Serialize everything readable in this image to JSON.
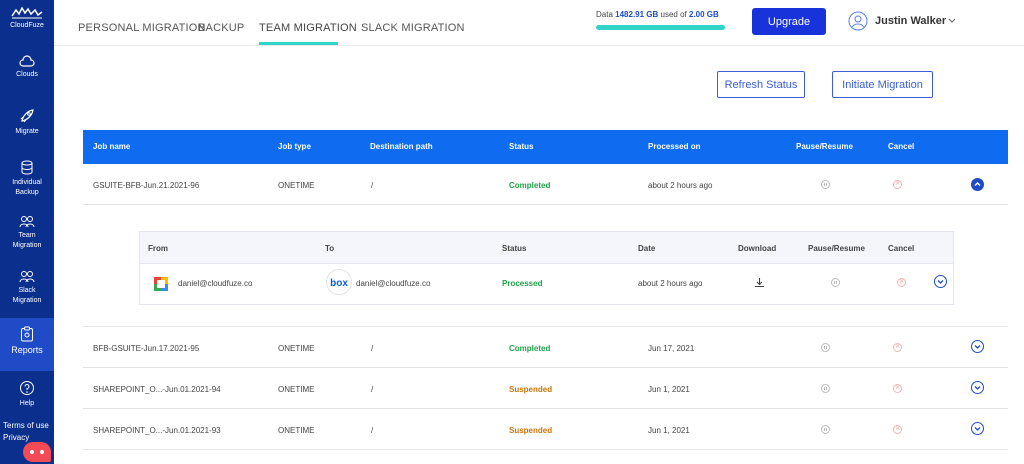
{
  "sidebar": {
    "logo_text": "CloudFuze",
    "items": [
      {
        "label": "Clouds",
        "icon": "cloud-icon"
      },
      {
        "label": "Migrate",
        "icon": "rocket-icon"
      },
      {
        "label": "Individual Backup",
        "icon": "database-icon"
      },
      {
        "label": "Team Migration",
        "icon": "users-icon"
      },
      {
        "label": "Slack Migration",
        "icon": "users-icon"
      },
      {
        "label": "Reports",
        "icon": "clipboard-icon"
      },
      {
        "label": "Help",
        "icon": "help-icon"
      }
    ],
    "footer_line1": "Terms of use",
    "footer_line2": "Privacy"
  },
  "tabs": [
    {
      "label": "PERSONAL MIGRATION"
    },
    {
      "label": "BACKUP"
    },
    {
      "label": "TEAM MIGRATION",
      "active": true
    },
    {
      "label": "SLACK MIGRATION"
    }
  ],
  "storage": {
    "prefix": "Data",
    "used": "1482.91 GB",
    "middle": "used of",
    "total": "2.00 GB"
  },
  "upgrade_label": "Upgrade",
  "user": {
    "name": "Justin Walker"
  },
  "actions": {
    "refresh": "Refresh Status",
    "initiate": "Initiate Migration"
  },
  "table": {
    "headers": [
      "Job name",
      "Job type",
      "Destination path",
      "Status",
      "Processed on",
      "Pause/Resume",
      "Cancel"
    ],
    "rows": [
      {
        "name": "GSUITE-BFB-Jun.21.2021-96",
        "type": "ONETIME",
        "path": "/",
        "status": "Completed",
        "processed": "about 2 hours ago",
        "expanded": true
      },
      {
        "name": "BFB-GSUITE-Jun.17.2021-95",
        "type": "ONETIME",
        "path": "/",
        "status": "Completed",
        "processed": "Jun 17, 2021"
      },
      {
        "name": "SHAREPOINT_O...-Jun.01.2021-94",
        "type": "ONETIME",
        "path": "/",
        "status": "Suspended",
        "processed": "Jun 1, 2021"
      },
      {
        "name": "SHAREPOINT_O...-Jun.01.2021-93",
        "type": "ONETIME",
        "path": "/",
        "status": "Suspended",
        "processed": "Jun 1, 2021"
      }
    ]
  },
  "subtable": {
    "headers": [
      "From",
      "To",
      "Status",
      "Date",
      "Download",
      "Pause/Resume",
      "Cancel"
    ],
    "row": {
      "from": "daniel@cloudfuze.co",
      "to": "daniel@cloudfuze.co",
      "status": "Processed",
      "date": "about 2 hours ago",
      "to_logo": "box"
    }
  },
  "colors": {
    "sidebar": "#0b2f8c",
    "header": "#0f6cf0",
    "accent": "#34d3c8",
    "completed": "#21a04a",
    "suspended": "#c9740a"
  }
}
